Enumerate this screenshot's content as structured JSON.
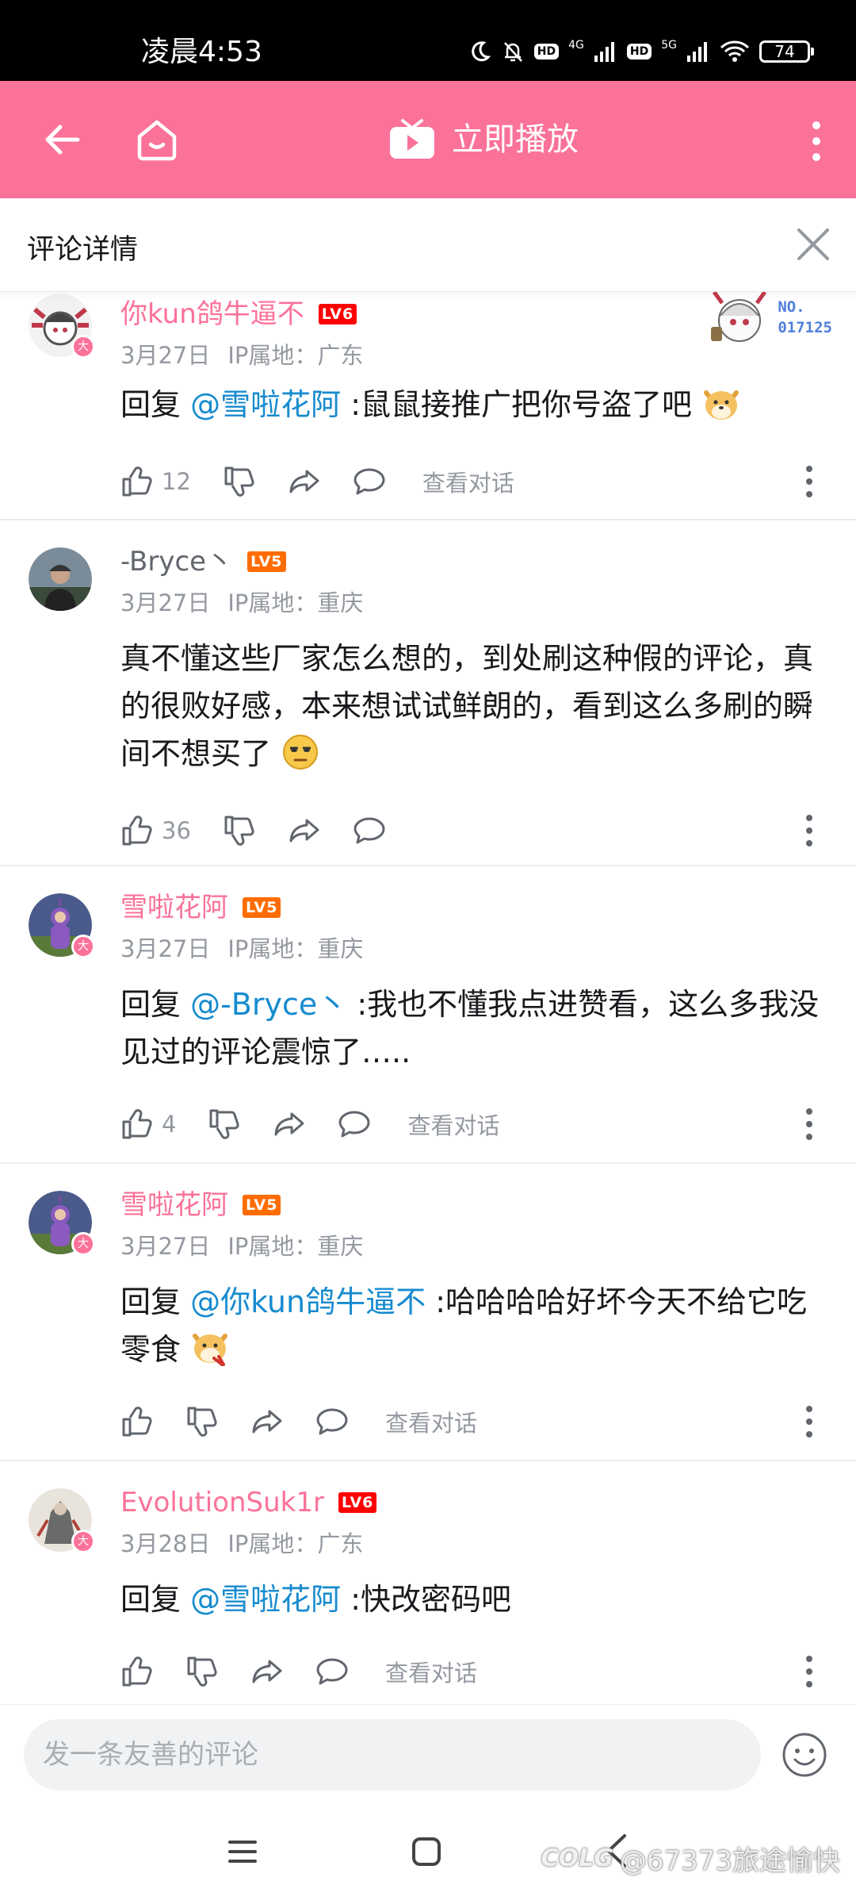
{
  "status_bar": {
    "time": "凌晨4:53",
    "battery": "74",
    "net1": "4G",
    "net2": "5G",
    "hd": "HD"
  },
  "header": {
    "play_label": "立即播放"
  },
  "subheader": {
    "title": "评论详情"
  },
  "nfc_badge": {
    "line1": "NO.",
    "line2": "017125"
  },
  "comments": [
    {
      "username": "你kun鸽牛逼不",
      "level": "LV6",
      "date": "3月27日",
      "ip": "IP属地：广东",
      "reply_prefix": "回复 ",
      "mention": "@雪啦花阿",
      "text": " :鼠鼠接推广把你号盗了吧",
      "likes": "12",
      "view_conversation": "查看对话",
      "badge": "大"
    },
    {
      "username": "-Bryce丶",
      "level": "LV5",
      "date": "3月27日",
      "ip": "IP属地：重庆",
      "text": "真不懂这些厂家怎么想的，到处刷这种假的评论，真的很败好感，本来想试试鲜朗的，看到这么多刷的瞬间不想买了",
      "likes": "36"
    },
    {
      "username": "雪啦花阿",
      "level": "LV5",
      "date": "3月27日",
      "ip": "IP属地：重庆",
      "reply_prefix": "回复 ",
      "mention": "@-Bryce丶",
      "text": " :我也不懂我点进赞看，这么多我没见过的评论震惊了…..",
      "likes": "4",
      "view_conversation": "查看对话",
      "badge": "大"
    },
    {
      "username": "雪啦花阿",
      "level": "LV5",
      "date": "3月27日",
      "ip": "IP属地：重庆",
      "reply_prefix": "回复 ",
      "mention": "@你kun鸽牛逼不",
      "text": " :哈哈哈哈好坏今天不给它吃零食",
      "view_conversation": "查看对话",
      "badge": "大"
    },
    {
      "username": "EvolutionSuk1r",
      "level": "LV6",
      "date": "3月28日",
      "ip": "IP属地：广东",
      "reply_prefix": "回复 ",
      "mention": "@雪啦花阿",
      "text": " :快改密码吧",
      "view_conversation": "查看对话",
      "badge": "大"
    }
  ],
  "composer": {
    "placeholder": "发一条友善的评论"
  },
  "watermark": {
    "logo": "COLG",
    "text": "@67373旅途愉快"
  },
  "colors": {
    "brand": "#fb7299",
    "mention": "#178bcf",
    "lv5": "#ff6c00",
    "lv6": "#ff0000"
  }
}
